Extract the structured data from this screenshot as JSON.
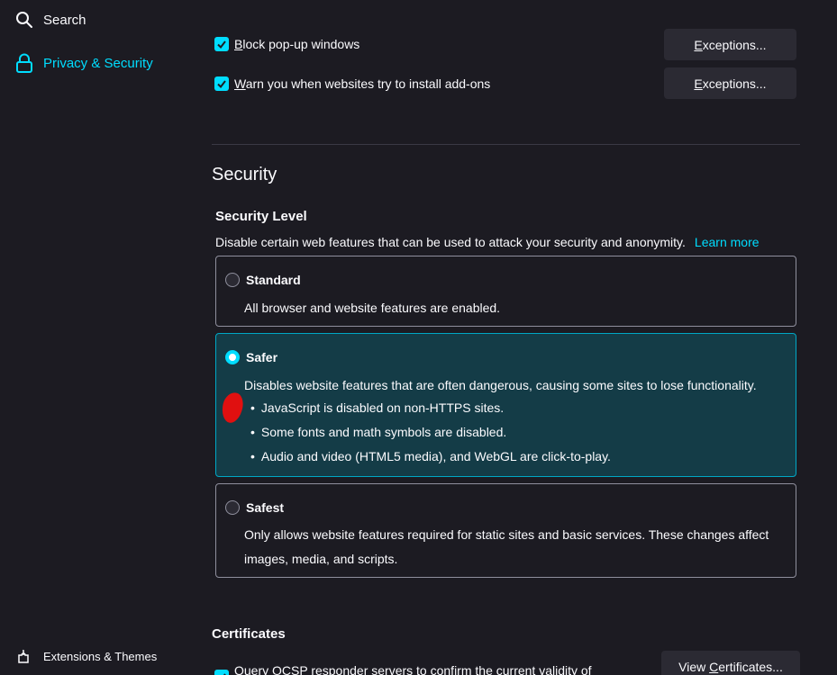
{
  "sidebar": {
    "search_label": "Search",
    "privacy_label": "Privacy & Security",
    "extensions_label": "Extensions & Themes"
  },
  "permissions": {
    "block_popups": {
      "prefix_u": "B",
      "rest": "lock pop-up windows",
      "checked": true
    },
    "warn_addons": {
      "prefix_u": "W",
      "rest": "arn you when websites try to install add-ons",
      "checked": true
    },
    "exceptions_label_u": "E",
    "exceptions_label_rest": "xceptions..."
  },
  "security": {
    "heading": "Security",
    "level_heading": "Security Level",
    "description": "Disable certain web features that can be used to attack your security and anonymity.",
    "learn_more": "Learn more",
    "levels": [
      {
        "title": "Standard",
        "text": "All browser and website features are enabled.",
        "selected": false
      },
      {
        "title": "Safer",
        "text": "Disables website features that are often dangerous, causing some sites to lose functionality.",
        "bullets": [
          "JavaScript is disabled on non-HTTPS sites.",
          "Some fonts and math symbols are disabled.",
          "Audio and video (HTML5 media), and WebGL are click-to-play."
        ],
        "selected": true
      },
      {
        "title": "Safest",
        "text_line1": "Only allows website features required for static sites and basic services. These changes affect",
        "text_line2": "images, media, and scripts.",
        "selected": false
      }
    ]
  },
  "certificates": {
    "heading": "Certificates",
    "ocsp_u": "Q",
    "ocsp_rest": "uery OCSP responder servers to confirm the current validity of",
    "view_label_pre": "View ",
    "view_label_u": "C",
    "view_label_rest": "ertificates..."
  },
  "colors": {
    "accent": "#00ddff",
    "background": "#1c1b22",
    "selected_card": "#143c47",
    "button": "#2b2a33"
  }
}
